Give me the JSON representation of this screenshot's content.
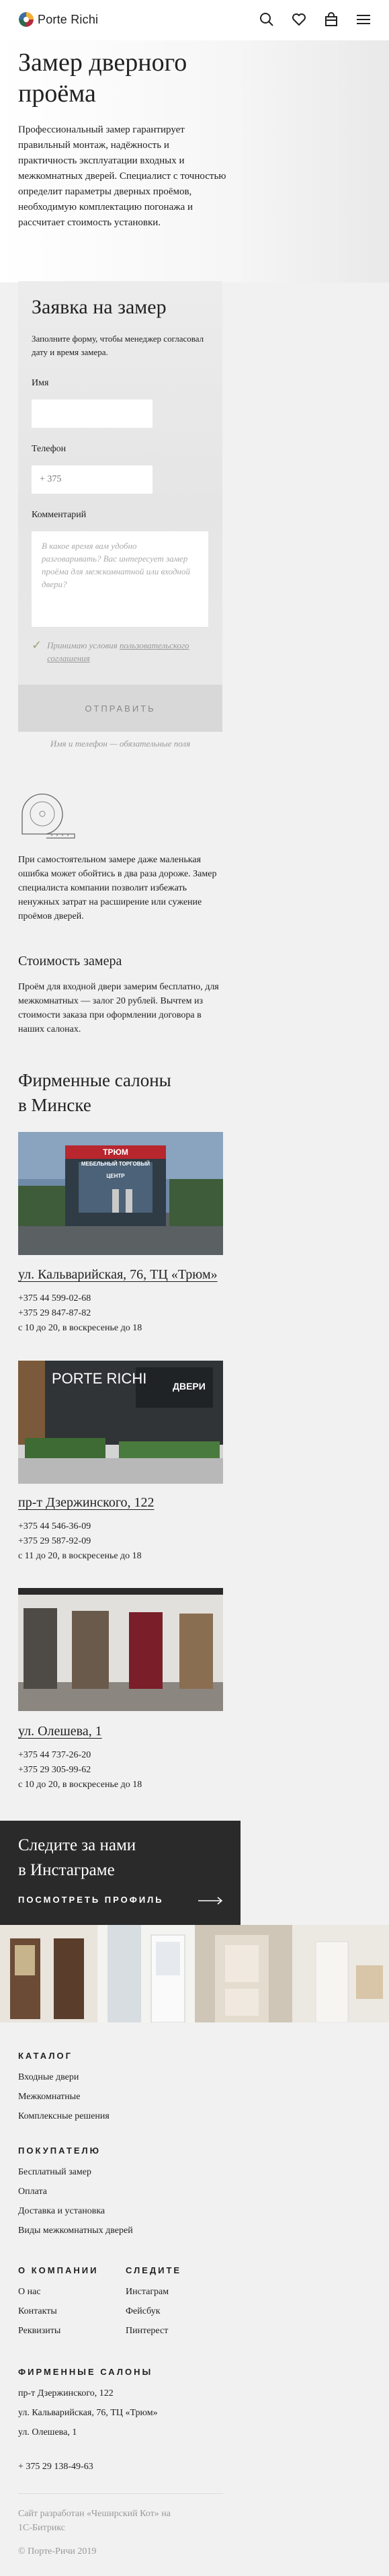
{
  "header": {
    "logo_text": "Porte Richi",
    "icons": [
      "search-icon",
      "heart-icon",
      "bag-icon",
      "menu-icon"
    ]
  },
  "hero": {
    "title_line1": "Замер дверного",
    "title_line2": "проёма",
    "intro": "Профессиональный замер гарантирует правильный монтаж, надёжность и практичность эксплуатации входных и межкомнатных дверей. Специалист с точностью определит параметры дверных проёмов, необходимую комплектацию погонажа и рассчитает стоимость установки."
  },
  "form": {
    "title": "Заявка на замер",
    "description": "Заполните форму, чтобы менеджер согласовал дату и время замера.",
    "name_label": "Имя",
    "name_value": "",
    "phone_label": "Телефон",
    "phone_placeholder": "+ 375",
    "comment_label": "Комментарий",
    "comment_placeholder": "В какое время вам удобно разговаривать? Вас интересует замер проёма для межкомнатной или входной двери?",
    "consent_text": "Принимаю условия",
    "consent_link": "пользовательского соглашения",
    "submit_label": "ОТПРАВИТЬ",
    "required_note": "Имя и телефон — обязательные поля"
  },
  "self_measure": {
    "text": "При самостоятельном замере даже маленькая ошибка может обойтись в два раза дороже. Замер специалиста компании позволит избежать ненужных затрат на расширение или сужение проёмов дверей."
  },
  "cost": {
    "title": "Стоимость замера",
    "text": "Проём для входной двери замерим бесплатно, для межкомнатных — залог 20 рублей. Вычтем из стоимости заказа при оформлении договора в наших салонах."
  },
  "salons": {
    "title_line1": "Фирменные салоны",
    "title_line2": "в Минске",
    "items": [
      {
        "address": "ул. Кальварийская, 76, ТЦ «Трюм»",
        "phone1": "+375 44 599-02-68",
        "phone2": "+375 29 847-87-82",
        "hours": "с 10 до 20, в воскресенье до 18",
        "sign": "ТРЮМ",
        "sign2": "МЕБЕЛЬНЫЙ ТОРГОВЫЙ ЦЕНТР"
      },
      {
        "address": "пр-т Дзержинского, 122",
        "phone1": "+375 44 546-36-09",
        "phone2": "+375 29 587-92-09",
        "hours": "с 11 до 20, в воскресенье до 18",
        "sign": "PORTE RICHI",
        "sign2": "ДВЕРИ"
      },
      {
        "address": "ул. Олешева, 1",
        "phone1": "+375 44 737-26-20",
        "phone2": "+375 29 305-99-62",
        "hours": "с 10 до 20, в воскресенье до 18"
      }
    ]
  },
  "instagram": {
    "title_line1": "Следите за нами",
    "title_line2": "в Инстаграме",
    "link_label": "ПОСМОТРЕТЬ ПРОФИЛЬ"
  },
  "footer": {
    "catalog": {
      "heading": "КАТАЛОГ",
      "items": [
        "Входные двери",
        "Межкомнатные",
        "Комплексные решения"
      ]
    },
    "buyers": {
      "heading": "ПОКУПАТЕЛЮ",
      "items": [
        "Бесплатный замер",
        "Оплата",
        "Доставка и установка",
        "Виды межкомнатных дверей"
      ]
    },
    "company": {
      "heading": "О КОМПАНИИ",
      "items": [
        "О нас",
        "Контакты",
        "Реквизиты"
      ]
    },
    "follow": {
      "heading": "СЛЕДИТЕ",
      "items": [
        "Инстаграм",
        "Фейсбук",
        "Пинтерест"
      ]
    },
    "salons": {
      "heading": "ФИРМЕННЫЕ САЛОНЫ",
      "items": [
        "пр-т Дзержинского, 122",
        "ул. Кальварийская, 76, ТЦ «Трюм»",
        "ул. Олешева, 1"
      ]
    },
    "phone": "+ 375 29 138-49-63",
    "credit_line1": "Сайт разработан «Чеширский Кот» на",
    "credit_line2": "1С-Битрикс",
    "copyright": "© Порте-Ричи 2019"
  }
}
